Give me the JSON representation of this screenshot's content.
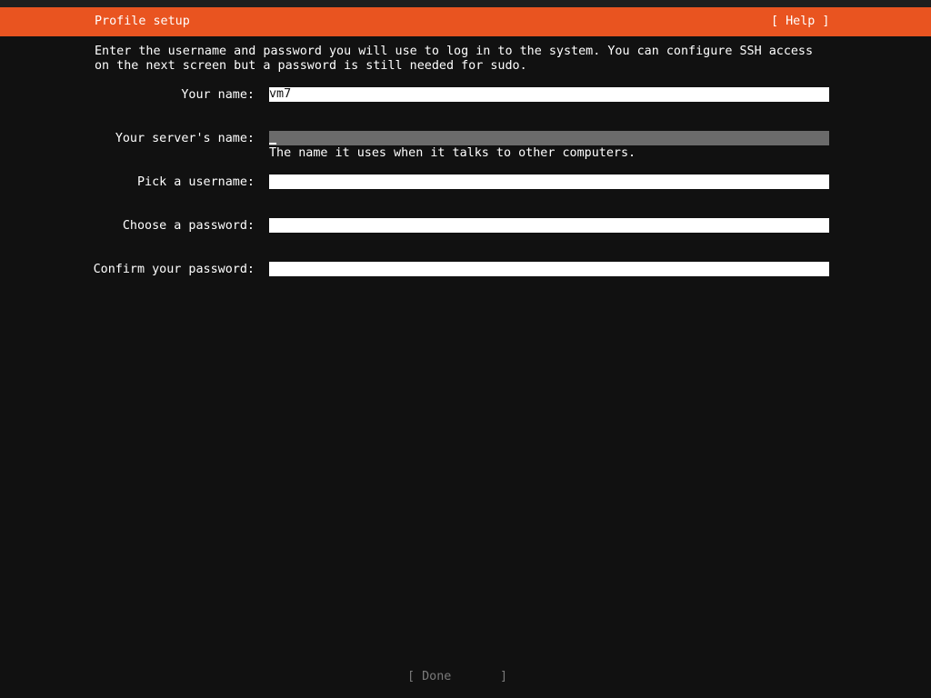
{
  "header": {
    "title": "Profile setup",
    "help_label": "[ Help ]"
  },
  "intro_text": "Enter the username and password you will use to log in to the system. You can configure SSH access on the next screen but a password is still needed for sudo.",
  "form": {
    "name": {
      "label": "Your name:",
      "value": "vm7"
    },
    "server_name": {
      "label": "Your server's name:",
      "value": "",
      "hint": "The name it uses when it talks to other computers."
    },
    "username": {
      "label": "Pick a username:",
      "value": ""
    },
    "password": {
      "label": "Choose a password:",
      "value": ""
    },
    "confirm_password": {
      "label": "Confirm your password:",
      "value": ""
    }
  },
  "footer": {
    "done_label": "[ Done",
    "done_bracket_close": "]"
  },
  "colors": {
    "accent": "#e95420",
    "background": "#111111",
    "field": "#ffffff",
    "focused_field": "#6b6b6b",
    "disabled_text": "#7a7a7a"
  }
}
